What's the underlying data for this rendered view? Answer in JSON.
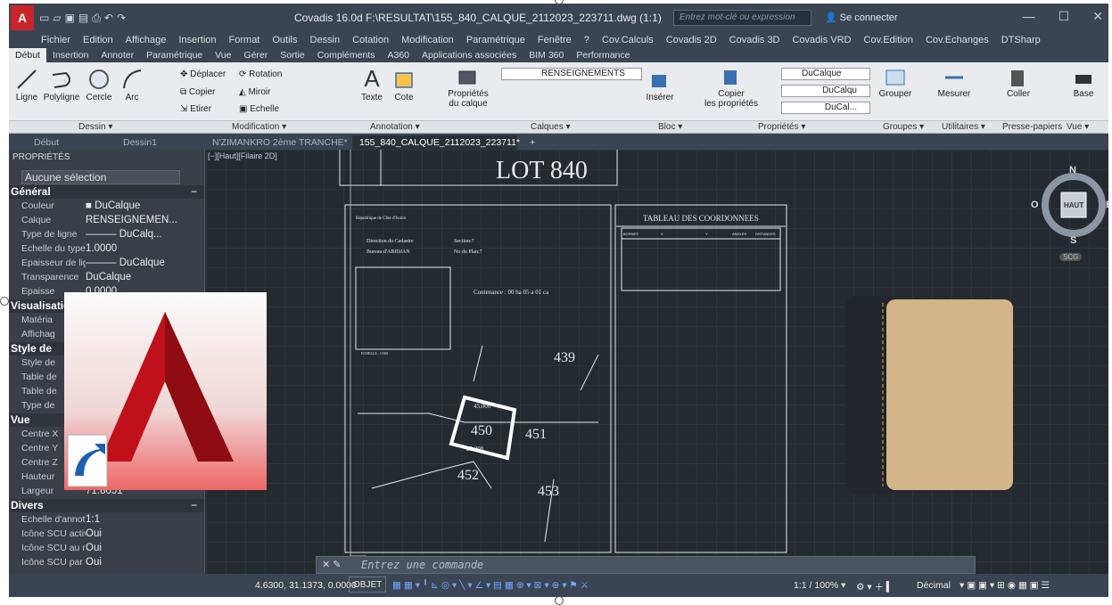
{
  "app": {
    "logo": "A",
    "title": "Covadis 16.0d    F:\\RESULTAT\\155_840_CALQUE_2112023_223711.dwg (1:1)",
    "search_placeholder": "Entrez mot-clé ou expression",
    "sign_in": "Se connecter"
  },
  "menubar": [
    "Fichier",
    "Edition",
    "Affichage",
    "Insertion",
    "Format",
    "Outils",
    "Dessin",
    "Cotation",
    "Modification",
    "Paramétrique",
    "Fenêtre",
    "?",
    "Cov.Calculs",
    "Covadis 2D",
    "Covadis 3D",
    "Covadis VRD",
    "Cov.Edition",
    "Cov.Echanges",
    "DTSharp"
  ],
  "ribbon_tabs": [
    "Début",
    "Insertion",
    "Annoter",
    "Paramétrique",
    "Vue",
    "Gérer",
    "Sortie",
    "Compléments",
    "A360",
    "Applications associées",
    "BIM 360",
    "Performance"
  ],
  "ribbon": {
    "dessin": [
      "Ligne",
      "Polyligne",
      "Cercle",
      "Arc"
    ],
    "modification": [
      "Déplacer",
      "Rotation",
      "Copier",
      "Miroir",
      "Etirer",
      "Echelle"
    ],
    "annotation": [
      "Texte",
      "Cote"
    ],
    "calques": {
      "props": "Propriétés",
      "props2": "du calque",
      "current": "RENSEIGNEMENTS"
    },
    "bloc": [
      "Insérer"
    ],
    "proprietes": {
      "copy": "Copier",
      "copy2": "les propriétés",
      "color": "DuCalque",
      "line1": "DuCalqu",
      "line2": "DuCal..."
    },
    "groupes": [
      "Grouper"
    ],
    "utilitaires": [
      "Mesurer"
    ],
    "presse": [
      "Coller"
    ],
    "base": [
      "Base"
    ]
  },
  "panels": [
    "Dessin ▾",
    "Modification ▾",
    "Annotation ▾",
    "Calques ▾",
    "Bloc ▾",
    "Propriétés ▾",
    "Groupes ▾",
    "Utilitaires ▾",
    "Presse-papiers",
    "Vue ▾"
  ],
  "doc_tabs": [
    "Début",
    "Dessin1",
    "N'ZIMANKRO 2ème TRANCHE*",
    "155_840_CALQUE_2112023_223711*"
  ],
  "properties": {
    "header": "PROPRIÉTÉS",
    "selection": "Aucune sélection",
    "general_title": "Général",
    "general": [
      {
        "k": "Couleur",
        "v": "■ DuCalque"
      },
      {
        "k": "Calque",
        "v": "RENSEIGNEMEN..."
      },
      {
        "k": "Type de ligne",
        "v": "——— DuCalq..."
      },
      {
        "k": "Echelle du type...",
        "v": "1.0000"
      },
      {
        "k": "Epaisseur de ligne",
        "v": "——— DuCalque"
      },
      {
        "k": "Transparence",
        "v": "DuCalque"
      },
      {
        "k": "Epaisse",
        "v": "0.0000"
      }
    ],
    "visual_title": "Visualisation",
    "visual": [
      {
        "k": "Matéria",
        "v": ""
      },
      {
        "k": "Affichag",
        "v": ""
      }
    ],
    "style_title": "Style de",
    "style": [
      {
        "k": "Style de",
        "v": ""
      },
      {
        "k": "Table de",
        "v": ""
      },
      {
        "k": "Table de",
        "v": ""
      },
      {
        "k": "Type de",
        "v": ""
      }
    ],
    "vue_title": "Vue",
    "vue": [
      {
        "k": "Centre X",
        "v": ""
      },
      {
        "k": "Centre Y",
        "v": ""
      },
      {
        "k": "Centre Z",
        "v": ""
      },
      {
        "k": "Hauteur",
        "v": ""
      },
      {
        "k": "Largeur",
        "v": "71.8051"
      }
    ],
    "divers_title": "Divers",
    "divers": [
      {
        "k": "Echelle d'annota...",
        "v": "1:1"
      },
      {
        "k": "Icône SCU active",
        "v": "Oui"
      },
      {
        "k": "Icône SCU au ni...",
        "v": "Oui"
      },
      {
        "k": "Icône SCU par f...",
        "v": "Oui"
      }
    ]
  },
  "viewport_label": "[−][Haut][Filaire 2D]",
  "drawing": {
    "title": "LOT 840",
    "table_title": "TABLEAU  DES  COORDONNEES",
    "table_headers": [
      "BORNES",
      "X",
      "Y",
      "ANGLES",
      "DISTANCES"
    ],
    "lots": [
      "439",
      "450",
      "451",
      "452",
      "453"
    ],
    "dim_45": "45.000",
    "dim_25": "25.000",
    "contenance": "Contenance :  00  ha 05  a 01  ca",
    "republique": "République de Côte d'Ivoire",
    "direction": "Direction du Cadastre",
    "bureau": "Bureau d'ABIDJAN",
    "section": "Section:7",
    "plan": "No du Plan:7",
    "echelle": "ECHELLE :  1/500"
  },
  "compass": {
    "n": "N",
    "s": "S",
    "e": "E",
    "w": "O",
    "top": "HAUT",
    "wcs": "SCG"
  },
  "command": {
    "placeholder": "Entrez une commande"
  },
  "status": {
    "coords": "4.6300, 31.1373, 0.0000",
    "mode": "OBJET",
    "scale": "1:1 / 100% ▾",
    "units": "Décimal"
  }
}
